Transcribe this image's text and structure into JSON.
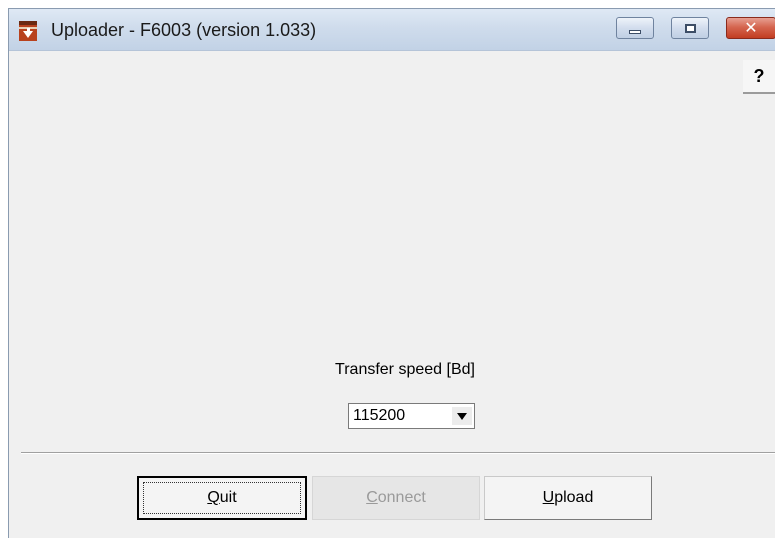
{
  "window": {
    "title": "Uploader - F6003 (version 1.033)",
    "controls": {
      "close_glyph": "✕"
    }
  },
  "help": {
    "label": "?"
  },
  "transfer": {
    "label": "Transfer speed [Bd]",
    "selected": "115200"
  },
  "buttons": {
    "quit": {
      "label": "Quit",
      "mnemonic": "Q",
      "rest": "uit"
    },
    "connect": {
      "label": "Connect",
      "mnemonic": "C",
      "rest": "onnect",
      "enabled": false
    },
    "upload": {
      "label": "Upload",
      "mnemonic": "U",
      "rest": "pload"
    }
  },
  "icons": {
    "app": "upload-arrow-icon",
    "minimize": "minimize-icon",
    "maximize": "maximize-icon",
    "close": "close-icon"
  },
  "colors": {
    "close_button": "#c23d22",
    "window_bg": "#f0f0f0",
    "disabled_text": "#9a9a9a"
  }
}
